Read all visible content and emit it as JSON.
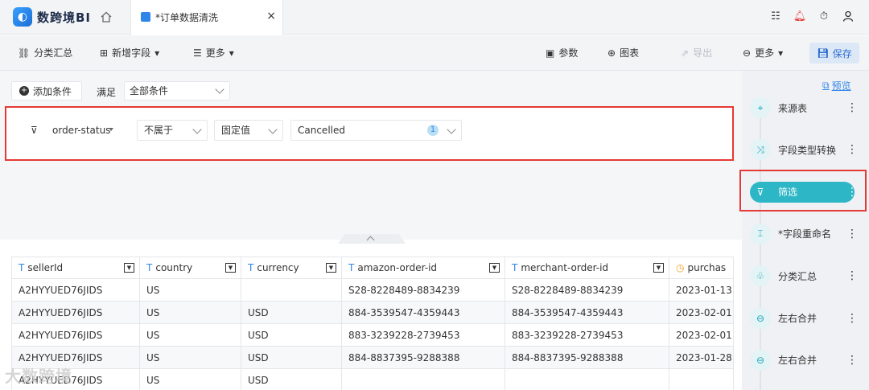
{
  "app": {
    "logo_text": "数跨境BI"
  },
  "tab": {
    "label": "*订单数据清洗",
    "close": "×"
  },
  "top_icons": [
    "list-icon",
    "bell-icon",
    "timer-icon",
    "user-icon"
  ],
  "toolbar": {
    "summary": "分类汇总",
    "add_field": "新增字段",
    "more_left": "更多",
    "params": "参数",
    "chart": "图表",
    "export": "导出",
    "more_right": "更多",
    "save": "保存"
  },
  "filter": {
    "add_condition": "添加条件",
    "satisfy_label": "满足",
    "satisfy_value": "全部条件",
    "field": "order-status",
    "operator": "不属于",
    "value_type": "固定值",
    "value": "Cancelled",
    "value_count": "1"
  },
  "table": {
    "columns": [
      {
        "name": "sellerId",
        "icon": "T"
      },
      {
        "name": "country",
        "icon": "T"
      },
      {
        "name": "currency",
        "icon": "T"
      },
      {
        "name": "amazon-order-id",
        "icon": "T"
      },
      {
        "name": "merchant-order-id",
        "icon": "T"
      },
      {
        "name": "purchas",
        "icon": "clock"
      }
    ],
    "rows": [
      [
        "A2HYYUED76JIDS",
        "US",
        "",
        "S28-8228489-8834239",
        "S28-8228489-8834239",
        "2023-01-13"
      ],
      [
        "A2HYYUED76JIDS",
        "US",
        "USD",
        "884-3539547-4359443",
        "884-3539547-4359443",
        "2023-02-01"
      ],
      [
        "A2HYYUED76JIDS",
        "US",
        "USD",
        "883-3239228-2739453",
        "883-3239228-2739453",
        "2023-02-01"
      ],
      [
        "A2HYYUED76JIDS",
        "US",
        "USD",
        "884-8837395-9288388",
        "884-8837395-9288388",
        "2023-01-28"
      ],
      [
        "A2HYYUED76JIDS",
        "US",
        "USD",
        "",
        "",
        ""
      ]
    ]
  },
  "watermark": "大数跨境",
  "flow": {
    "preview": "预览",
    "nodes": [
      {
        "label": "来源表",
        "icon": "source-icon",
        "active": false
      },
      {
        "label": "字段类型转换",
        "icon": "shuffle-icon",
        "active": false
      },
      {
        "label": "筛选",
        "icon": "filter-icon",
        "active": true
      },
      {
        "label": "*字段重命名",
        "icon": "rename-icon",
        "active": false
      },
      {
        "label": "分类汇总",
        "icon": "hierarchy-icon",
        "active": false
      },
      {
        "label": "左右合并",
        "icon": "merge-icon",
        "active": false
      },
      {
        "label": "左右合并",
        "icon": "merge-icon",
        "active": false
      }
    ]
  },
  "colors": {
    "accent": "#2db7c6",
    "link": "#2f86e8",
    "highlight": "#e53935"
  }
}
